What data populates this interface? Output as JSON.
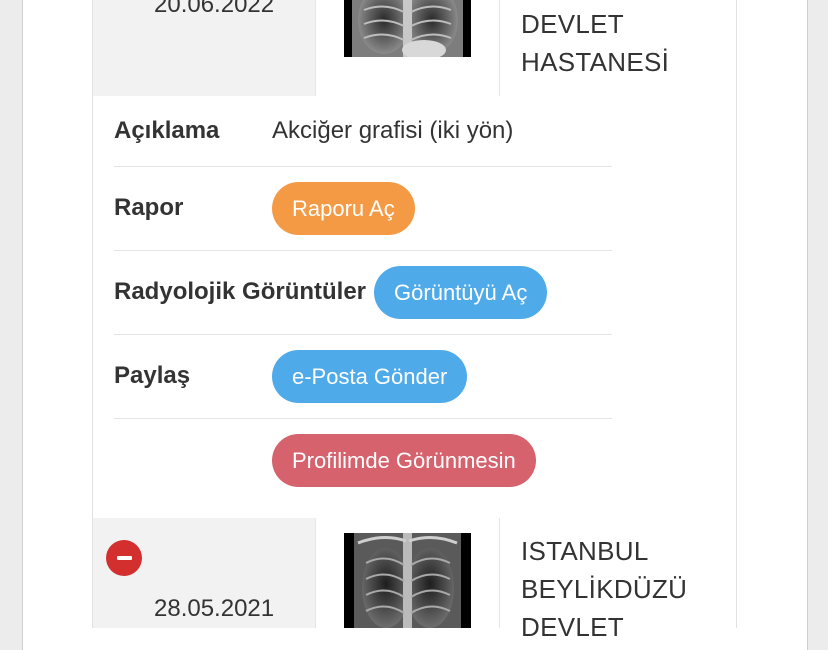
{
  "records": [
    {
      "date": "20.06.2022",
      "hospital_lines": [
        "DEVLET",
        "HASTANESİ"
      ],
      "image": "chest-xray-thumbnail"
    },
    {
      "date": "28.05.2021",
      "hospital_lines": [
        "ISTANBUL",
        "BEYLİKDÜZÜ",
        "DEVLET"
      ],
      "image": "chest-xray-thumbnail",
      "remove_icon": "minus-circle-icon"
    }
  ],
  "details": {
    "description_label": "Açıklama",
    "description_value": "Akciğer grafisi (iki yön)",
    "report_label": "Rapor",
    "report_button": "Raporu Aç",
    "images_label": "Radyolojik Görüntüler",
    "images_button": "Görüntüyü Aç",
    "share_label": "Paylaş",
    "share_button": "e-Posta Gönder",
    "hide_button": "Profilimde Görünmesin"
  },
  "colors": {
    "orange": "#f49a45",
    "blue": "#4faaea",
    "red": "#d6626e",
    "remove": "#d32f2f"
  }
}
